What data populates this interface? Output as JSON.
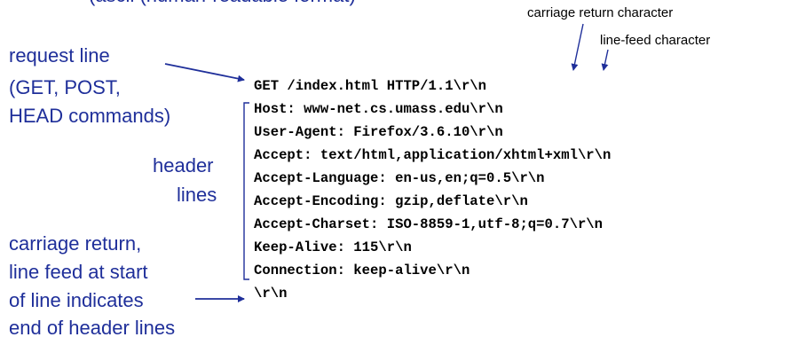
{
  "header_cut": "(ascii (human-readable format)",
  "annotations": {
    "carriage_return": "carriage return character",
    "line_feed": "line-feed character",
    "request_line": [
      "request line",
      "(GET, POST,",
      "HEAD commands)"
    ],
    "header_lines": [
      "header",
      "lines"
    ],
    "blank_line": [
      "carriage return,",
      "line feed at start",
      "of line indicates",
      "end of header lines"
    ]
  },
  "request_line": "GET /index.html HTTP/1.1\\r\\n",
  "header_lines": [
    "Host: www-net.cs.umass.edu\\r\\n",
    "User-Agent: Firefox/3.6.10\\r\\n",
    "Accept: text/html,application/xhtml+xml\\r\\n",
    "Accept-Language: en-us,en;q=0.5\\r\\n",
    "Accept-Encoding: gzip,deflate\\r\\n",
    "Accept-Charset: ISO-8859-1,utf-8;q=0.7\\r\\n",
    "Keep-Alive: 115\\r\\n",
    "Connection: keep-alive\\r\\n"
  ],
  "blank_line": "\\r\\n",
  "colors": {
    "annotation": "#1f2f9a",
    "code": "#000000"
  }
}
